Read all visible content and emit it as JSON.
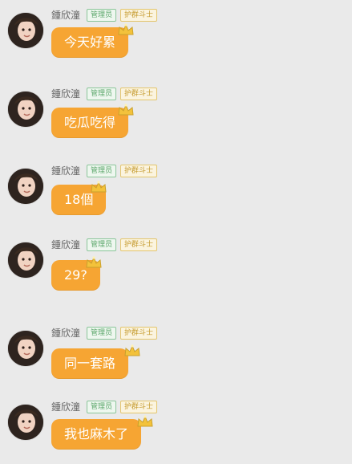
{
  "messages": [
    {
      "sender": "鍾欣潼",
      "badges": [
        "管理员",
        "护群斗士"
      ],
      "text": "今天好累"
    },
    {
      "sender": "鍾欣潼",
      "badges": [
        "管理员",
        "护群斗士"
      ],
      "text": "吃瓜吃得"
    },
    {
      "sender": "鍾欣潼",
      "badges": [
        "管理员",
        "护群斗士"
      ],
      "text": "18個"
    },
    {
      "sender": "鍾欣潼",
      "badges": [
        "管理员",
        "护群斗士"
      ],
      "text": "29?"
    },
    {
      "sender": "鍾欣潼",
      "badges": [
        "管理员",
        "护群斗士"
      ],
      "text": "同一套路"
    },
    {
      "sender": "鍾欣潼",
      "badges": [
        "管理员",
        "护群斗士"
      ],
      "text": "我也麻木了"
    }
  ],
  "colors": {
    "bubble": "#f6a533",
    "background": "#eaeaea",
    "admin_badge": "#5aa66a",
    "guard_badge": "#c59a2d"
  },
  "icons": {
    "avatar": "avatar-photo",
    "crown": "crown-icon"
  }
}
